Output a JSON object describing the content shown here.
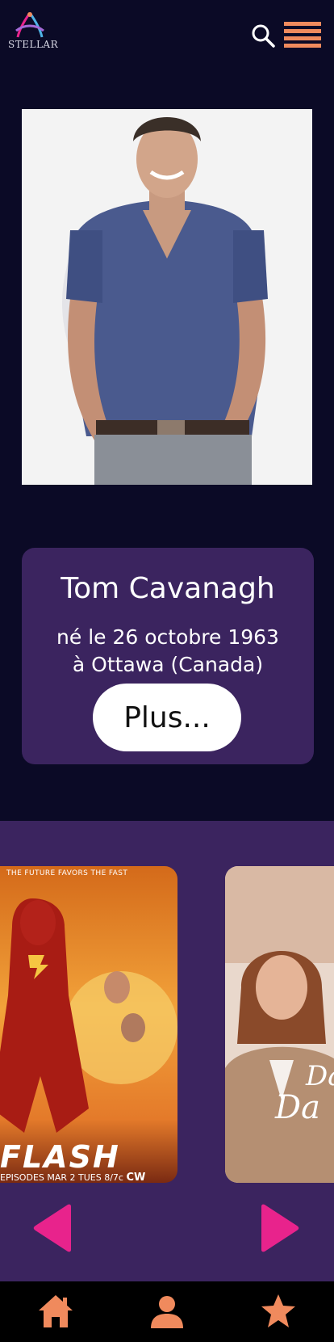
{
  "header": {
    "logo_text": "STELLAR",
    "icons": [
      "search-icon",
      "menu-icon"
    ]
  },
  "actor": {
    "name": "Tom Cavanagh",
    "birth": "né le 26 octobre 1963\nà Ottawa (Canada)",
    "more_label": "Plus..."
  },
  "carousel": {
    "posters": [
      {
        "tagline": "THE FUTURE FAVORS THE FAST",
        "title": "FLASH",
        "bottom_text": "EPISODES MAR 2 TUES 8/7c",
        "network": "CW"
      },
      {
        "title": "Da",
        "subtitle": "Da"
      }
    ],
    "icons": [
      "chevron-left-icon",
      "chevron-right-icon"
    ]
  },
  "bottom_nav": {
    "icons": [
      "home-icon",
      "profile-icon",
      "star-icon"
    ]
  },
  "colors": {
    "background": "#0b0a26",
    "card": "#3b245f",
    "accent_pink": "#e8238c",
    "accent_orange": "#f08a5d"
  }
}
